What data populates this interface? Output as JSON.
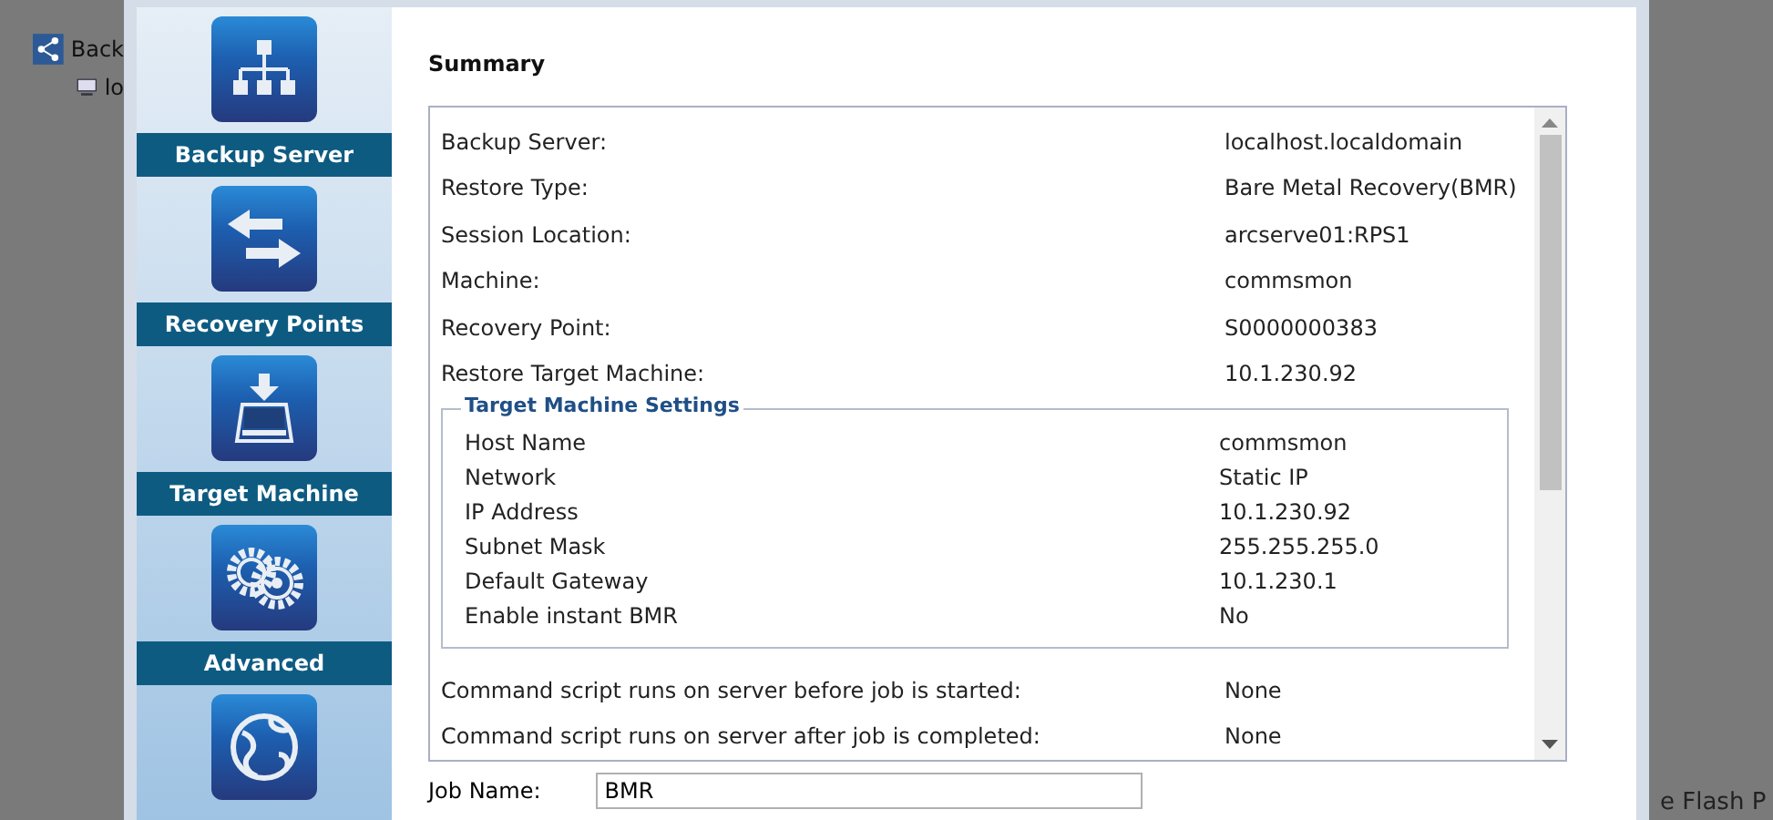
{
  "background": {
    "tree": [
      {
        "label": "Back",
        "kind": "server"
      },
      {
        "label": "lo",
        "kind": "computer"
      }
    ],
    "footer_text": "e Flash P"
  },
  "nav": [
    {
      "label": "Backup Server",
      "kind": "server"
    },
    {
      "label": "Recovery Points",
      "kind": "arrows"
    },
    {
      "label": "Target Machine",
      "kind": "drive"
    },
    {
      "label": "Advanced",
      "kind": "gears"
    },
    {
      "kind": "globe"
    }
  ],
  "summary": {
    "title": "Summary",
    "rows": [
      {
        "label": "Backup Server:",
        "value": "localhost.localdomain"
      },
      {
        "label": "Restore Type:",
        "value": "Bare Metal Recovery(BMR)"
      },
      {
        "label": "Session Location:",
        "value": "arcserve01:RPS1"
      },
      {
        "label": "Machine:",
        "value": "commsmon"
      },
      {
        "label": "Recovery Point:",
        "value": "S0000000383"
      },
      {
        "label": "Restore Target Machine:",
        "value": "10.1.230.92"
      }
    ],
    "target_settings": {
      "title": "Target Machine Settings",
      "rows": [
        {
          "label": "Host Name",
          "value": "commsmon"
        },
        {
          "label": "Network",
          "value": "Static IP"
        },
        {
          "label": "IP Address",
          "value": "10.1.230.92"
        },
        {
          "label": "Subnet Mask",
          "value": "255.255.255.0"
        },
        {
          "label": "Default Gateway",
          "value": "10.1.230.1"
        },
        {
          "label": "Enable instant BMR",
          "value": "No"
        }
      ]
    },
    "scripts": [
      {
        "label": "Command script runs on server before job is started:",
        "value": "None"
      },
      {
        "label": "Command script runs on server after job is completed:",
        "value": "None"
      }
    ]
  },
  "job_name": {
    "label": "Job Name:",
    "value": "BMR"
  }
}
